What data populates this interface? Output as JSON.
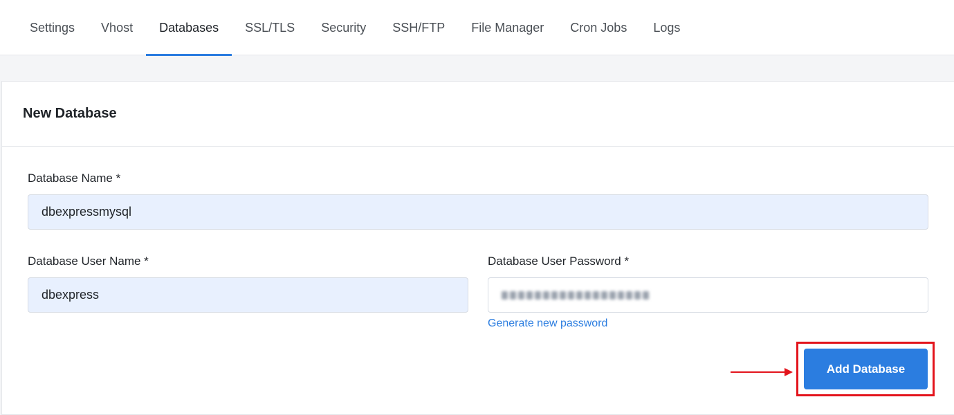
{
  "tabs": [
    {
      "label": "Settings",
      "active": false
    },
    {
      "label": "Vhost",
      "active": false
    },
    {
      "label": "Databases",
      "active": true
    },
    {
      "label": "SSL/TLS",
      "active": false
    },
    {
      "label": "Security",
      "active": false
    },
    {
      "label": "SSH/FTP",
      "active": false
    },
    {
      "label": "File Manager",
      "active": false
    },
    {
      "label": "Cron Jobs",
      "active": false
    },
    {
      "label": "Logs",
      "active": false
    }
  ],
  "card": {
    "title": "New Database"
  },
  "form": {
    "db_name_label": "Database Name *",
    "db_name_value": "dbexpressmysql",
    "db_user_label": "Database User Name *",
    "db_user_value": "dbexpress",
    "db_password_label": "Database User Password *",
    "db_password_value": "(blurred)",
    "generate_password_link": "Generate new password",
    "submit_label": "Add Database"
  },
  "colors": {
    "accent": "#2b7de0",
    "highlight": "#e3141c",
    "autofill_bg": "#e8f0fe"
  }
}
